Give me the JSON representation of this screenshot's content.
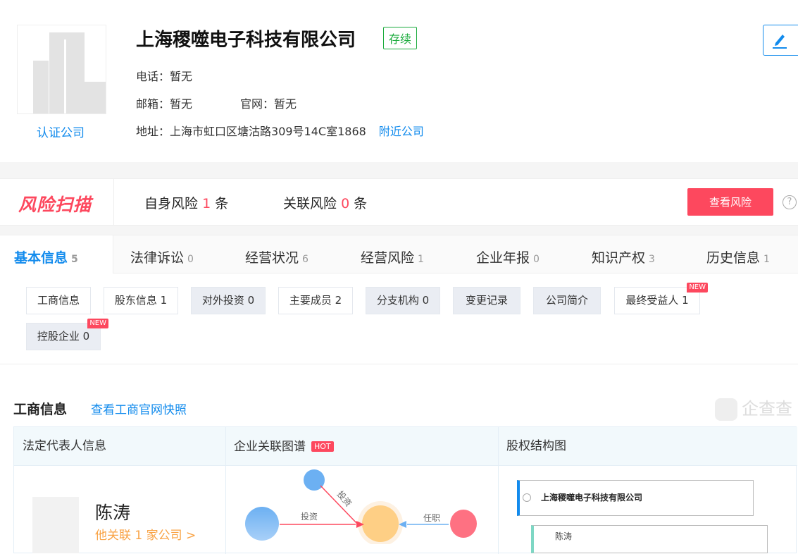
{
  "company": {
    "name": "上海稷噬电子科技有限公司",
    "status": "存续",
    "certified_label": "认证公司",
    "phone_label": "电话：",
    "phone": "暂无",
    "email_label": "邮箱：",
    "email": "暂无",
    "website_label": "官网：",
    "website": "暂无",
    "address_label": "地址：",
    "address": "上海市虹口区塘沽路309号14C室1868",
    "nearby_label": "附近公司"
  },
  "risk": {
    "logo": "风险扫描",
    "self_label": "自身风险",
    "self_count": "1",
    "related_label": "关联风险",
    "related_count": "0",
    "unit": "条",
    "button": "查看风险",
    "help": "?"
  },
  "tabs": [
    {
      "label": "基本信息",
      "count": "5"
    },
    {
      "label": "法律诉讼",
      "count": "0"
    },
    {
      "label": "经营状况",
      "count": "6"
    },
    {
      "label": "经营风险",
      "count": "1"
    },
    {
      "label": "企业年报",
      "count": "0"
    },
    {
      "label": "知识产权",
      "count": "3"
    },
    {
      "label": "历史信息",
      "count": "1"
    }
  ],
  "subtabs": [
    {
      "label": "工商信息"
    },
    {
      "label": "股东信息 1"
    },
    {
      "label": "对外投资 0"
    },
    {
      "label": "主要成员 2"
    },
    {
      "label": "分支机构 0"
    },
    {
      "label": "变更记录"
    },
    {
      "label": "公司简介"
    },
    {
      "label": "最终受益人 1",
      "badge": "NEW"
    },
    {
      "label": "控股企业 0",
      "badge": "NEW"
    }
  ],
  "section": {
    "title": "工商信息",
    "link": "查看工商官网快照",
    "watermark": "企查查"
  },
  "table": {
    "headers": [
      "法定代表人信息",
      "企业关联图谱",
      "股权结构图"
    ],
    "hot": "HOT",
    "person": {
      "name": "陈涛",
      "related": "他关联 1 家公司 >"
    },
    "graph": {
      "edge1": "投资",
      "edge2": "投资",
      "edge3": "任职"
    },
    "equity": {
      "root": "上海稷噬电子科技有限公司",
      "child": "陈涛"
    }
  }
}
